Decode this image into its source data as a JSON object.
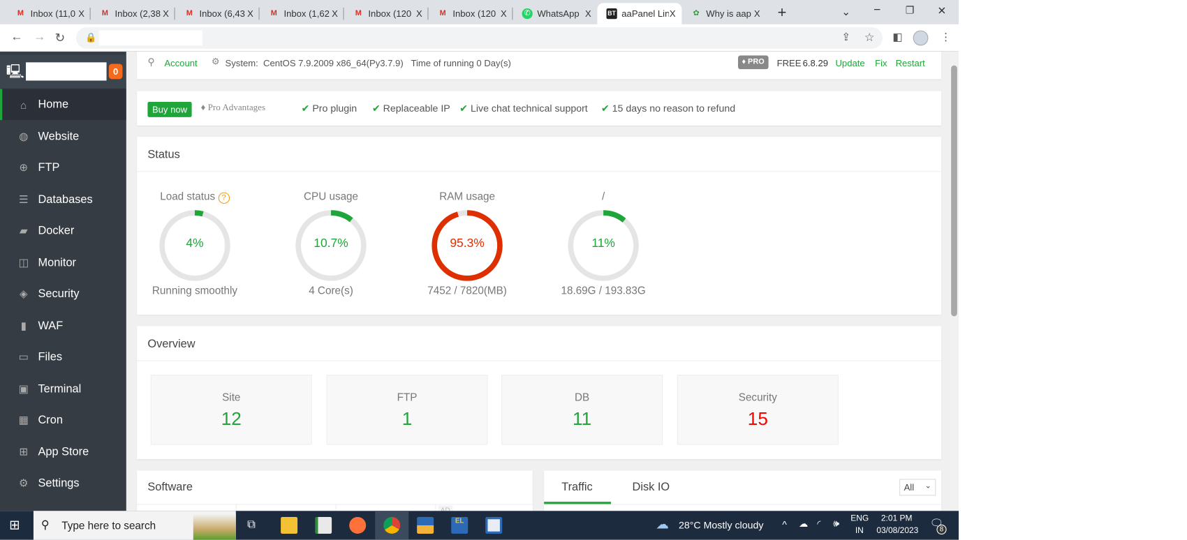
{
  "browser": {
    "tabs": [
      {
        "label": "Inbox (11,0",
        "icon": "gmail-icon"
      },
      {
        "label": "Inbox (2,38",
        "icon": "gmail-icon"
      },
      {
        "label": "Inbox (6,43",
        "icon": "gmail-icon"
      },
      {
        "label": "Inbox (1,62",
        "icon": "gmail-icon"
      },
      {
        "label": "Inbox (120",
        "icon": "gmail-icon"
      },
      {
        "label": "Inbox (120",
        "icon": "gmail-icon"
      },
      {
        "label": "WhatsApp",
        "icon": "whatsapp-icon"
      },
      {
        "label": "aaPanel Lin",
        "icon": "bt-icon",
        "fav": "BT"
      },
      {
        "label": "Why is aap",
        "icon": "site-icon"
      }
    ],
    "close": "X",
    "new_tab": "+",
    "minimize": "−",
    "restore": "❐",
    "window_close": "✕",
    "tab_search": "⌄"
  },
  "header": {
    "account": "Account",
    "system_label": "System:",
    "system": "CentOS 7.9.2009 x86_64(Py3.7.9)",
    "uptime": "Time of running 0 Day(s)",
    "pro_badge": "PRO",
    "edition": "FREE",
    "version": "6.8.29",
    "update": "Update",
    "fix": "Fix",
    "restart": "Restart"
  },
  "sidebar": {
    "badge": "0",
    "items": [
      {
        "label": "Home",
        "icon": "⌂"
      },
      {
        "label": "Website",
        "icon": "◍"
      },
      {
        "label": "FTP",
        "icon": "⊕"
      },
      {
        "label": "Databases",
        "icon": "☰"
      },
      {
        "label": "Docker",
        "icon": "▰"
      },
      {
        "label": "Monitor",
        "icon": "◫"
      },
      {
        "label": "Security",
        "icon": "◈"
      },
      {
        "label": "WAF",
        "icon": "▮"
      },
      {
        "label": "Files",
        "icon": "▭"
      },
      {
        "label": "Terminal",
        "icon": "▣"
      },
      {
        "label": "Cron",
        "icon": "▦"
      },
      {
        "label": "App Store",
        "icon": "⊞"
      },
      {
        "label": "Settings",
        "icon": "⚙"
      }
    ]
  },
  "promo": {
    "buy": "Buy now",
    "advantages": "Pro Advantages",
    "features": [
      "Pro plugin",
      "Replaceable IP",
      "Live chat technical support",
      "15 days no reason to refund"
    ]
  },
  "status": {
    "title": "Status",
    "gauges": [
      {
        "label": "Load status",
        "value": "4%",
        "percent": 4,
        "sub": "Running smoothly",
        "color": "#20a53a",
        "help": "?"
      },
      {
        "label": "CPU usage",
        "value": "10.7%",
        "percent": 10.7,
        "sub": "4 Core(s)",
        "color": "#20a53a"
      },
      {
        "label": "RAM usage",
        "value": "95.3%",
        "percent": 95.3,
        "sub": "7452 / 7820(MB)",
        "color": "#dd2f00"
      },
      {
        "label": "/",
        "value": "11%",
        "percent": 11,
        "sub": "18.69G / 193.83G",
        "color": "#20a53a"
      }
    ]
  },
  "overview": {
    "title": "Overview",
    "items": [
      {
        "label": "Site",
        "value": "12",
        "color": "#20a53a"
      },
      {
        "label": "FTP",
        "value": "1",
        "color": "#20a53a"
      },
      {
        "label": "DB",
        "value": "11",
        "color": "#20a53a"
      },
      {
        "label": "Security",
        "value": "15",
        "color": "#ff0000"
      }
    ]
  },
  "software": {
    "title": "Software",
    "ad": "AD"
  },
  "traffic": {
    "tabs": [
      "Traffic",
      "Disk IO"
    ],
    "select": "All"
  },
  "taskbar": {
    "search": "Type here to search",
    "weather": "28°C  Mostly cloudy",
    "lang1": "ENG",
    "lang2": "IN",
    "time": "2:01 PM",
    "date": "03/08/2023",
    "notifications": "8"
  }
}
